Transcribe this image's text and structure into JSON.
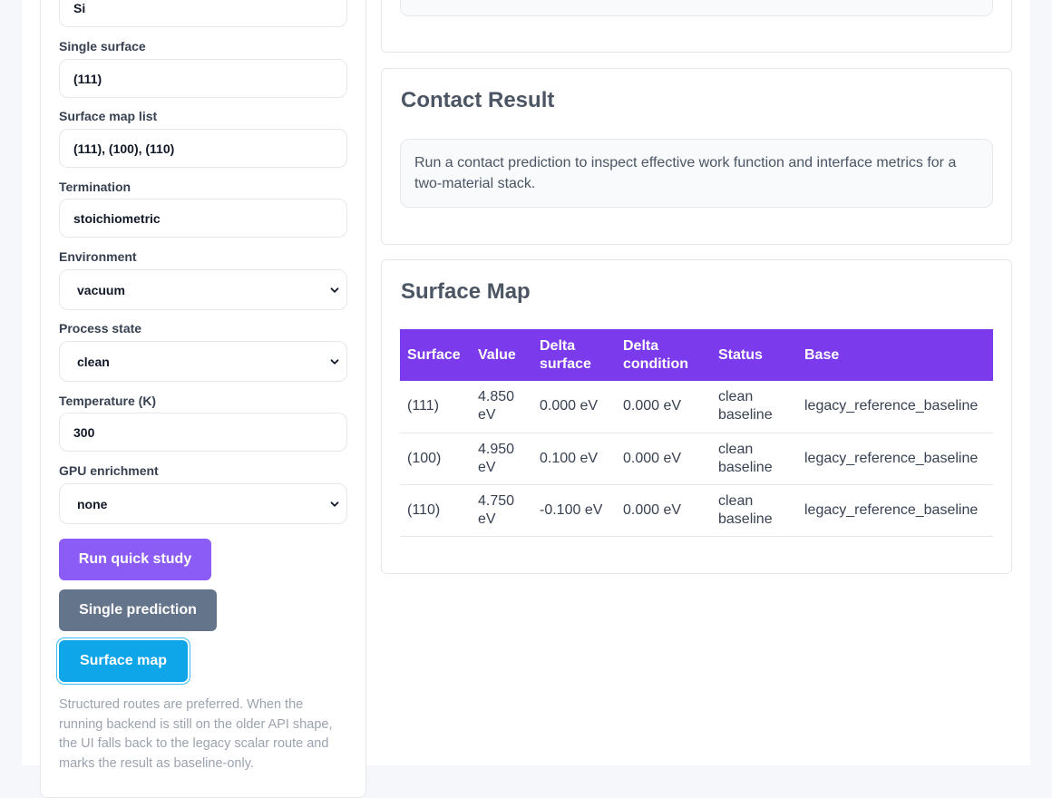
{
  "form": {
    "material_value": "Si",
    "single_surface_label": "Single surface",
    "single_surface_value": "(111)",
    "surface_map_label": "Surface map list",
    "surface_map_value": "(111), (100), (110)",
    "termination_label": "Termination",
    "termination_value": "stoichiometric",
    "environment_label": "Environment",
    "environment_value": "vacuum",
    "process_label": "Process state",
    "process_value": "clean",
    "temperature_label": "Temperature (K)",
    "temperature_value": "300",
    "gpu_label": "GPU enrichment",
    "gpu_value": "none"
  },
  "buttons": {
    "run_quick": "Run quick study",
    "single_prediction": "Single prediction",
    "surface_map": "Surface map"
  },
  "note": "Structured routes are preferred. When the running backend is still on the older API shape, the UI falls back to the legacy scalar route and marks the result as baseline-only.",
  "contact": {
    "title": "Contact Result",
    "message": "Run a contact prediction to inspect effective work function and interface metrics for a two-material stack."
  },
  "surface_map": {
    "title": "Surface Map",
    "headers": [
      "Surface",
      "Value",
      "Delta surface",
      "Delta condition",
      "Status",
      "Base"
    ],
    "rows": [
      [
        "(111)",
        "4.850 eV",
        "0.000 eV",
        "0.000 eV",
        "clean baseline",
        "legacy_reference_baseline"
      ],
      [
        "(100)",
        "4.950 eV",
        "0.100 eV",
        "0.000 eV",
        "clean baseline",
        "legacy_reference_baseline"
      ],
      [
        "(110)",
        "4.750 eV",
        "-0.100 eV",
        "0.000 eV",
        "clean baseline",
        "legacy_reference_baseline"
      ]
    ]
  },
  "colors": {
    "accent_purple": "#8b5cf6",
    "table_header": "#7c3aed",
    "secondary_gray": "#64748b",
    "active_blue": "#0ea5e9"
  }
}
